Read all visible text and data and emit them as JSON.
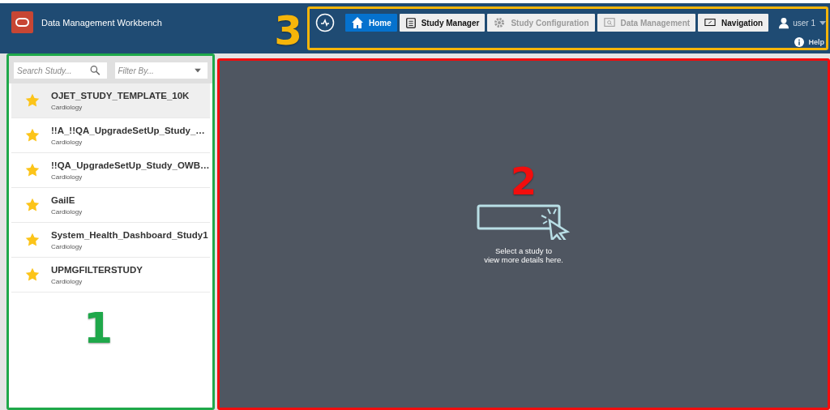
{
  "app": {
    "title": "Data Management Workbench"
  },
  "nav": {
    "callout": {
      "label": "3",
      "color": "#f5b50a"
    },
    "tabs": [
      {
        "label": "Home",
        "kind": "home",
        "selected": true,
        "disabled": false
      },
      {
        "label": "Study Manager",
        "kind": "clipboard",
        "selected": false,
        "disabled": false
      },
      {
        "label": "Study Configuration",
        "kind": "gear",
        "selected": false,
        "disabled": true
      },
      {
        "label": "Data Management",
        "kind": "search",
        "selected": false,
        "disabled": true
      },
      {
        "label": "Navigation",
        "kind": "screen",
        "selected": false,
        "disabled": false
      }
    ],
    "user": "user 1",
    "help": "Help"
  },
  "study_list": {
    "callout": {
      "label": "1",
      "color": "#1fa84a"
    },
    "search": {
      "placeholder": "Search Study..."
    },
    "filter": {
      "placeholder": "Filter By..."
    },
    "items": [
      {
        "name": "OJET_STUDY_TEMPLATE_10K",
        "area": "Cardiology",
        "selected": true
      },
      {
        "name": "!!A_!!QA_UpgradeSetUp_Study_…",
        "area": "Cardiology",
        "selected": false
      },
      {
        "name": "!!QA_UpgradeSetUp_Study_OWB…",
        "area": "Cardiology",
        "selected": false
      },
      {
        "name": "GailE",
        "area": "Cardiology",
        "selected": false
      },
      {
        "name": "System_Health_Dashboard_Study1",
        "area": "Cardiology",
        "selected": false
      },
      {
        "name": "UPMGFILTERSTUDY",
        "area": "Cardiology",
        "selected": false
      }
    ]
  },
  "detail": {
    "callout": {
      "label": "2",
      "color": "#f20d0d"
    },
    "message": [
      "Select a study to",
      "view more details here."
    ]
  }
}
